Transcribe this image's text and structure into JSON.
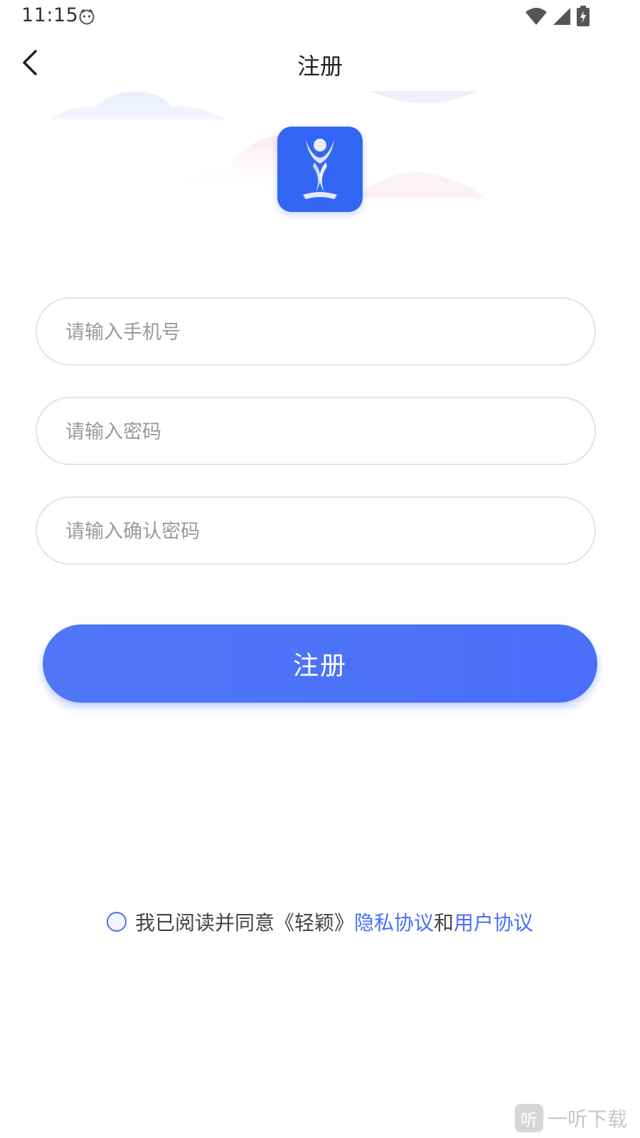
{
  "status_bar": {
    "time": "11:15"
  },
  "nav": {
    "title": "注册"
  },
  "form": {
    "phone_placeholder": "请输入手机号",
    "password_placeholder": "请输入密码",
    "confirm_password_placeholder": "请输入确认密码"
  },
  "register_button": {
    "label": "注册"
  },
  "agreement": {
    "prefix": "我已阅读并同意《轻颖》",
    "privacy_link": "隐私协议",
    "conjunction": "和",
    "user_link": "用户协议"
  },
  "watermark": {
    "badge": "听",
    "text": "一听下载"
  },
  "colors": {
    "accent": "#4a6ff9",
    "logo_bg": "#3366f5"
  }
}
